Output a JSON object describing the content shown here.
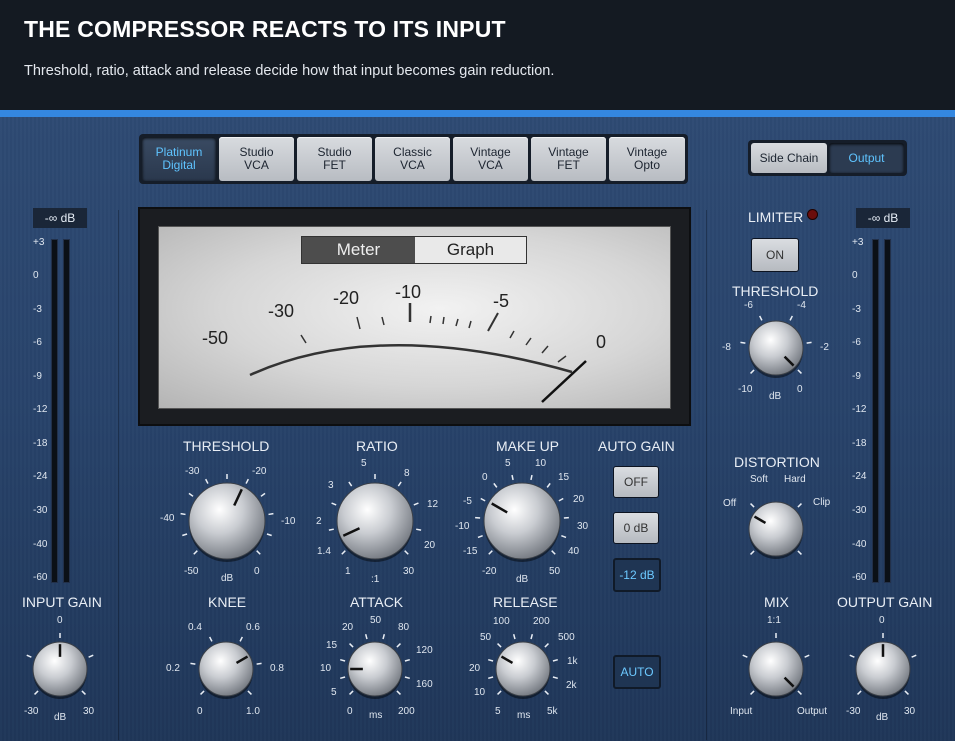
{
  "header": {
    "title": "THE COMPRESSOR REACTS TO ITS INPUT",
    "subtitle": "Threshold, ratio, attack and release decide how that input becomes gain reduction."
  },
  "colors": {
    "accent": "#3487e0",
    "panel": "#2b466e",
    "active_text": "#5fc4ff",
    "led": "#6b0d0d"
  },
  "models": [
    {
      "line1": "Platinum",
      "line2": "Digital",
      "active": true
    },
    {
      "line1": "Studio",
      "line2": "VCA",
      "active": false
    },
    {
      "line1": "Studio",
      "line2": "FET",
      "active": false
    },
    {
      "line1": "Classic",
      "line2": "VCA",
      "active": false
    },
    {
      "line1": "Vintage",
      "line2": "VCA",
      "active": false
    },
    {
      "line1": "Vintage",
      "line2": "FET",
      "active": false
    },
    {
      "line1": "Vintage",
      "line2": "Opto",
      "active": false
    }
  ],
  "side_switch": {
    "left": "Side Chain",
    "right": "Output",
    "selected": "Output"
  },
  "meter": {
    "tab_meter": "Meter",
    "tab_graph": "Graph",
    "selected_tab": "Meter",
    "scale": [
      "-50",
      "-30",
      "-20",
      "-10",
      "-5",
      "0"
    ],
    "needle_db": 0
  },
  "input_meter": {
    "readout": "-∞ dB",
    "scale": [
      "+3",
      "0",
      "-3",
      "-6",
      "-9",
      "-12",
      "-18",
      "-24",
      "-30",
      "-40",
      "-60"
    ]
  },
  "output_meter": {
    "readout": "-∞ dB",
    "scale": [
      "+3",
      "0",
      "-3",
      "-6",
      "-9",
      "-12",
      "-18",
      "-24",
      "-30",
      "-40",
      "-60"
    ]
  },
  "knobs": {
    "threshold": {
      "label": "THRESHOLD",
      "unit": "dB",
      "scale": [
        "-50",
        "-40",
        "-30",
        "-20",
        "-10",
        "0"
      ]
    },
    "ratio": {
      "label": "RATIO",
      "unit": ":1",
      "scale": [
        "1",
        "1.4",
        "2",
        "3",
        "5",
        "8",
        "12",
        "20",
        "30"
      ]
    },
    "makeup": {
      "label": "MAKE UP",
      "unit": "dB",
      "scale": [
        "-20",
        "-15",
        "-10",
        "-5",
        "0",
        "5",
        "10",
        "15",
        "20",
        "30",
        "40",
        "50"
      ]
    },
    "knee": {
      "label": "KNEE",
      "scale": [
        "0",
        "0.2",
        "0.4",
        "0.6",
        "0.8",
        "1.0"
      ]
    },
    "attack": {
      "label": "ATTACK",
      "unit": "ms",
      "scale": [
        "0",
        "5",
        "10",
        "15",
        "20",
        "50",
        "80",
        "120",
        "160",
        "200"
      ]
    },
    "release": {
      "label": "RELEASE",
      "unit": "ms",
      "scale": [
        "5",
        "10",
        "20",
        "50",
        "100",
        "200",
        "500",
        "1k",
        "2k",
        "5k"
      ]
    },
    "input_gain": {
      "label": "INPUT GAIN",
      "unit": "dB",
      "scale": [
        "-30",
        "0",
        "30"
      ]
    },
    "limiter_threshold": {
      "label": "THRESHOLD",
      "unit": "dB",
      "scale": [
        "-10",
        "-8",
        "-6",
        "-4",
        "-2",
        "0"
      ]
    },
    "distortion": {
      "label": "DISTORTION",
      "scale": [
        "Off",
        "Soft",
        "Hard",
        "Clip"
      ]
    },
    "mix": {
      "label": "MIX",
      "scale": [
        "Input",
        "1:1",
        "Output"
      ]
    },
    "output_gain": {
      "label": "OUTPUT GAIN",
      "unit": "dB",
      "scale": [
        "-30",
        "0",
        "30"
      ]
    }
  },
  "auto_gain": {
    "label": "AUTO GAIN",
    "options": [
      "OFF",
      "0 dB",
      "-12 dB"
    ],
    "selected": "-12 dB"
  },
  "auto_button": "AUTO",
  "limiter": {
    "label": "LIMITER",
    "button": "ON"
  }
}
